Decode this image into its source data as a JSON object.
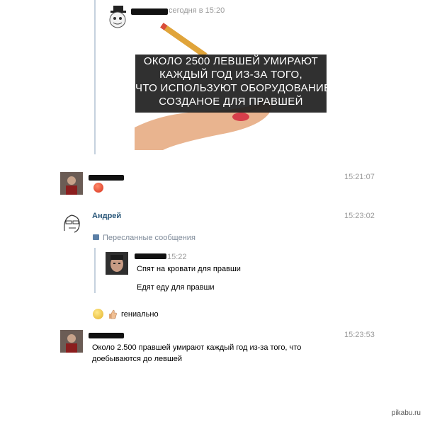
{
  "post": {
    "timestamp": "сегодня в 15:20",
    "image_caption": [
      "ОКОЛО 2500 ЛЕВШЕЙ УМИРАЮТ",
      "КАЖДЫЙ ГОД ИЗ-ЗА ТОГО,",
      "ЧТО ИСПОЛЬЗУЮТ ОБОРУДОВАНИЕ,",
      "СОЗДАНОЕ ДЛЯ ПРАВШЕЙ"
    ]
  },
  "messages": [
    {
      "time": "15:21:07"
    },
    {
      "author": "Андрей",
      "time": "15:23:02",
      "forwarded_title": "Пересланные сообщения",
      "forwarded": {
        "time": "15:22",
        "lines": [
          "Спят на кровати для правши",
          "Едят еду для правши"
        ]
      },
      "reply": "гениально"
    },
    {
      "time": "15:23:53",
      "lines": [
        "Около 2.500 правшей умирают каждый год из-за того, что",
        "доебываются до левшей"
      ]
    }
  ],
  "watermark": "pikabu.ru"
}
